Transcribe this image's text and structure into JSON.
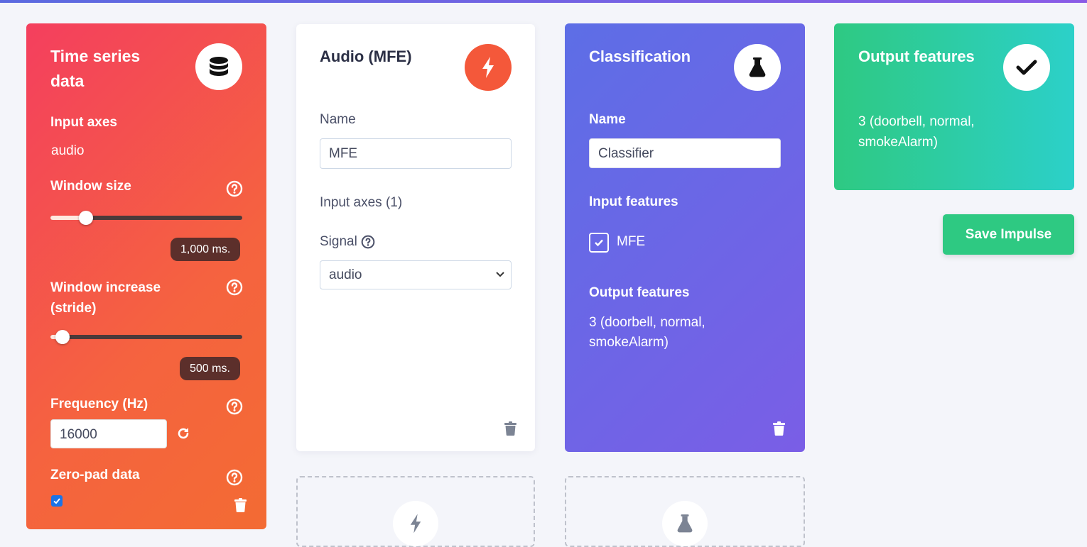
{
  "ts_block": {
    "title_line1": "Time series",
    "title_line2": "data",
    "input_axes_label": "Input axes",
    "input_axes_value": "audio",
    "window_size_label": "Window size",
    "window_size_value": "1,000 ms.",
    "window_size_fraction": 0.19,
    "window_increase_label_line1": "Window increase",
    "window_increase_label_line2": "(stride)",
    "window_increase_value": "500 ms.",
    "window_increase_fraction": 0.07,
    "frequency_label": "Frequency (Hz)",
    "frequency_value": "16000",
    "zeropad_label": "Zero-pad data",
    "zeropad_checked": true
  },
  "mfe_block": {
    "title": "Audio (MFE)",
    "name_label": "Name",
    "name_value": "MFE",
    "input_axes_label": "Input axes (1)",
    "signal_label": "Signal",
    "signal_value": "audio"
  },
  "cls_block": {
    "title": "Classification",
    "name_label": "Name",
    "name_value": "Classifier",
    "input_features_label": "Input features",
    "input_feature_item": "MFE",
    "output_features_label": "Output features",
    "output_line1": "3 (doorbell, normal,",
    "output_line2": "smokeAlarm)"
  },
  "out_block": {
    "title": "Output features",
    "line1": "3 (doorbell, normal,",
    "line2": "smokeAlarm)"
  },
  "save_button": "Save Impulse",
  "icons": {
    "ts": "database-icon",
    "mfe": "bolt-icon",
    "cls": "flask-icon",
    "out": "check-icon",
    "help": "question-circle-icon",
    "refresh": "refresh-icon",
    "trash": "trash-icon"
  },
  "colors": {
    "ts_gradient": [
      "#f43f5e",
      "#f36b33"
    ],
    "cls_gradient": [
      "#5d6ee6",
      "#7a5ee6"
    ],
    "out_gradient": [
      "#2ec982",
      "#2cd0c9"
    ],
    "accent_orange": "#f4583a",
    "save_green": "#2ec982"
  }
}
